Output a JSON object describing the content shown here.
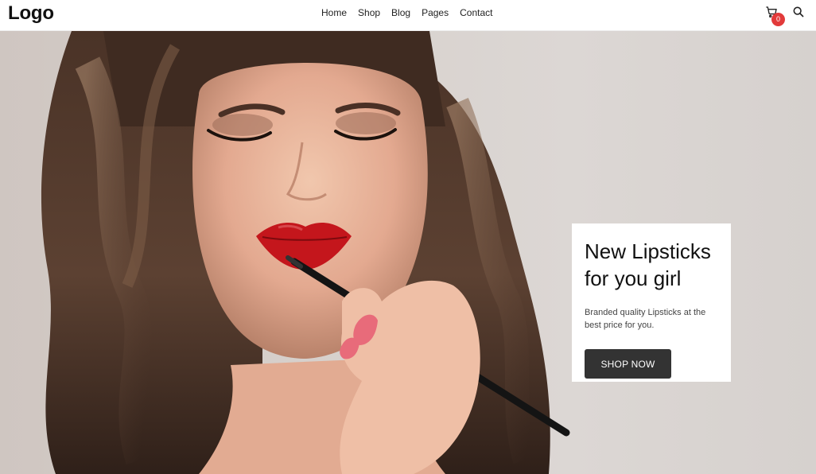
{
  "header": {
    "logo": "Logo",
    "nav": [
      "Home",
      "Shop",
      "Blog",
      "Pages",
      "Contact"
    ],
    "cart_icon": "cart-icon",
    "cart_count": "0",
    "search_icon": "search-icon"
  },
  "hero": {
    "title": "New Lipsticks for you girl",
    "text": "Branded quality Lipsticks at the best price for you.",
    "button_label": "SHOP NOW"
  },
  "colors": {
    "badge": "#e23a3a",
    "button": "#333333",
    "lipstick": "#c4161c"
  }
}
